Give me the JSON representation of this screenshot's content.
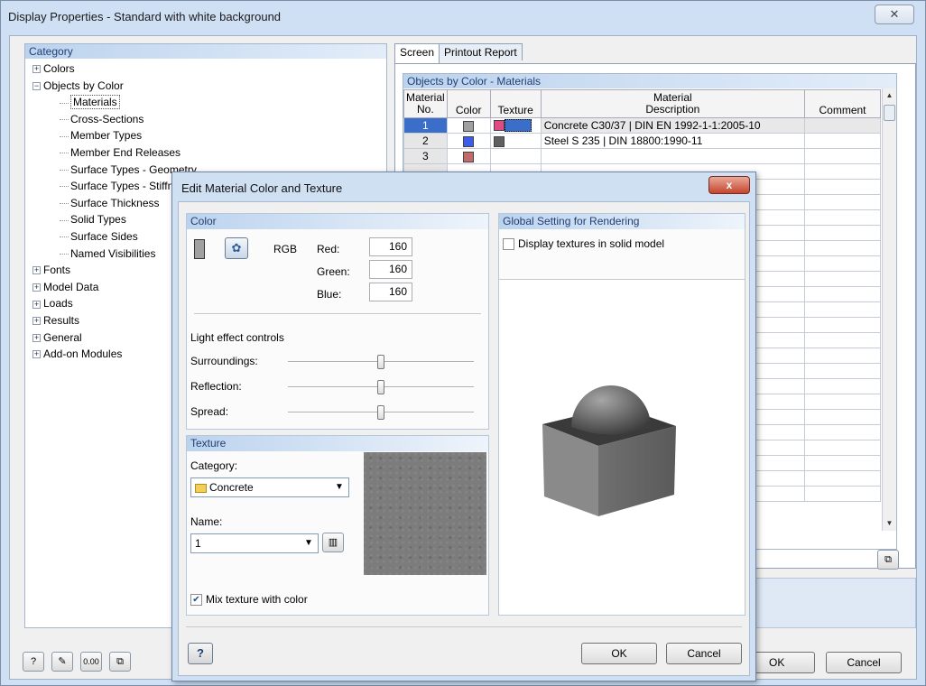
{
  "main_window": {
    "title": "Display Properties - Standard with white background",
    "close_label": "✕"
  },
  "category": {
    "header": "Category",
    "items": [
      {
        "label": "Colors",
        "level": 0,
        "expander": "+"
      },
      {
        "label": "Objects by Color",
        "level": 0,
        "expander": "−"
      },
      {
        "label": "Materials",
        "level": 1,
        "selected": true
      },
      {
        "label": "Cross-Sections",
        "level": 1
      },
      {
        "label": "Member Types",
        "level": 1
      },
      {
        "label": "Member End Releases",
        "level": 1
      },
      {
        "label": "Surface Types - Geometry",
        "level": 1
      },
      {
        "label": "Surface Types - Stiffness",
        "level": 1
      },
      {
        "label": "Surface Thickness",
        "level": 1
      },
      {
        "label": "Solid Types",
        "level": 1
      },
      {
        "label": "Surface Sides",
        "level": 1
      },
      {
        "label": "Named Visibilities",
        "level": 1
      },
      {
        "label": "Fonts",
        "level": 0,
        "expander": "+"
      },
      {
        "label": "Model Data",
        "level": 0,
        "expander": "+"
      },
      {
        "label": "Loads",
        "level": 0,
        "expander": "+"
      },
      {
        "label": "Results",
        "level": 0,
        "expander": "+"
      },
      {
        "label": "General",
        "level": 0,
        "expander": "+"
      },
      {
        "label": "Add-on Modules",
        "level": 0,
        "expander": "+"
      }
    ]
  },
  "tabs": [
    {
      "label": "Screen",
      "active": true
    },
    {
      "label": "Printout Report",
      "active": false
    }
  ],
  "materials_grid": {
    "header": "Objects by Color - Materials",
    "columns": {
      "no_line1": "Material",
      "no_line2": "No.",
      "color": "Color",
      "texture": "Texture",
      "desc_line1": "Material",
      "desc_line2": "Description",
      "comment": "Comment"
    },
    "rows": [
      {
        "no": "1",
        "color": "#a0a0a0",
        "texture": "#e04b84",
        "description": "Concrete C30/37 | DIN EN 1992-1-1:2005-10",
        "comment": ""
      },
      {
        "no": "2",
        "color": "#3d5ce8",
        "texture": "#606060",
        "description": "Steel S 235 | DIN 18800:1990-11",
        "comment": ""
      },
      {
        "no": "3",
        "color": "#c26a6a",
        "texture": "",
        "description": "",
        "comment": ""
      }
    ],
    "empty_row_count": 22
  },
  "main_buttons": {
    "ok": "OK",
    "cancel": "Cancel",
    "tool_icons": [
      "help-icon",
      "edit-icon",
      "units-icon",
      "export-icon"
    ],
    "units_glyph": "0.00"
  },
  "dialog": {
    "title": "Edit Material Color and Texture",
    "close_label": "x",
    "color": {
      "header": "Color",
      "rgb_label": "RGB",
      "red_label": "Red:",
      "green_label": "Green:",
      "blue_label": "Blue:",
      "red": "160",
      "green": "160",
      "blue": "160",
      "swatch_color": "#a0a0a0"
    },
    "light": {
      "title": "Light effect controls",
      "surroundings_label": "Surroundings:",
      "reflection_label": "Reflection:",
      "spread_label": "Spread:",
      "surroundings": 0.5,
      "reflection": 0.5,
      "spread": 0.5
    },
    "texture": {
      "header": "Texture",
      "category_label": "Category:",
      "category_value": "Concrete",
      "name_label": "Name:",
      "name_value": "1",
      "mix_label": "Mix texture with color",
      "mix_checked": true
    },
    "global": {
      "header": "Global Setting for Rendering",
      "display_textures_label": "Display textures in solid model",
      "display_textures_checked": false
    },
    "ok": "OK",
    "cancel": "Cancel"
  }
}
